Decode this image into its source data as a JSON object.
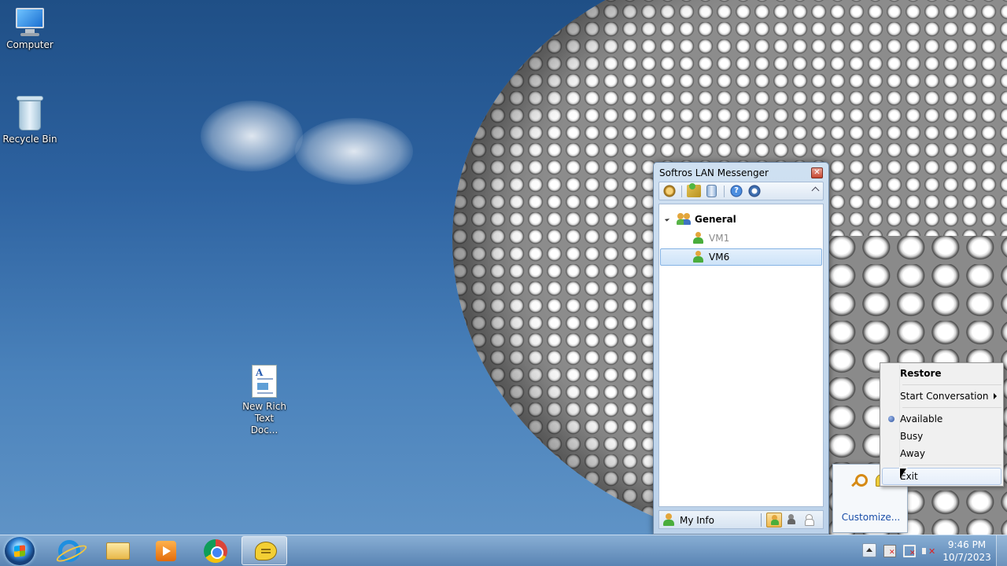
{
  "desktop": {
    "icons": [
      {
        "label": "Computer"
      },
      {
        "label": "Recycle Bin"
      },
      {
        "label": "New Rich Text Doc..."
      }
    ]
  },
  "messenger": {
    "title": "Softros LAN Messenger",
    "toolbar": {
      "icons": [
        "settings-icon",
        "add-contact-icon",
        "address-book-icon",
        "help-icon",
        "info-icon",
        "collapse-icon"
      ]
    },
    "groups": [
      {
        "name": "General",
        "expanded": true,
        "users": [
          {
            "name": "VM1",
            "status": "offline"
          },
          {
            "name": "VM6",
            "status": "available",
            "selected": true
          }
        ]
      }
    ],
    "status_bar": {
      "my_info_label": "My Info",
      "status_buttons": [
        "available",
        "busy",
        "away"
      ],
      "active_status": "available"
    }
  },
  "tray_overflow": {
    "icons": [
      "key-icon",
      "messenger-icon"
    ],
    "customize_label": "Customize..."
  },
  "context_menu": {
    "items": [
      {
        "label": "Restore",
        "bold": true
      },
      {
        "label": "Start Conversation",
        "submenu": true
      },
      {
        "label": "Available",
        "checked": true
      },
      {
        "label": "Busy"
      },
      {
        "label": "Away"
      },
      {
        "label": "Exit",
        "hover": true
      }
    ]
  },
  "taskbar": {
    "pinned": [
      "internet-explorer-icon",
      "file-explorer-icon",
      "media-player-icon",
      "chrome-icon",
      "lan-messenger-icon"
    ],
    "active_app": "lan-messenger-icon",
    "clock": {
      "time": "9:46 PM",
      "date": "10/7/2023"
    }
  }
}
